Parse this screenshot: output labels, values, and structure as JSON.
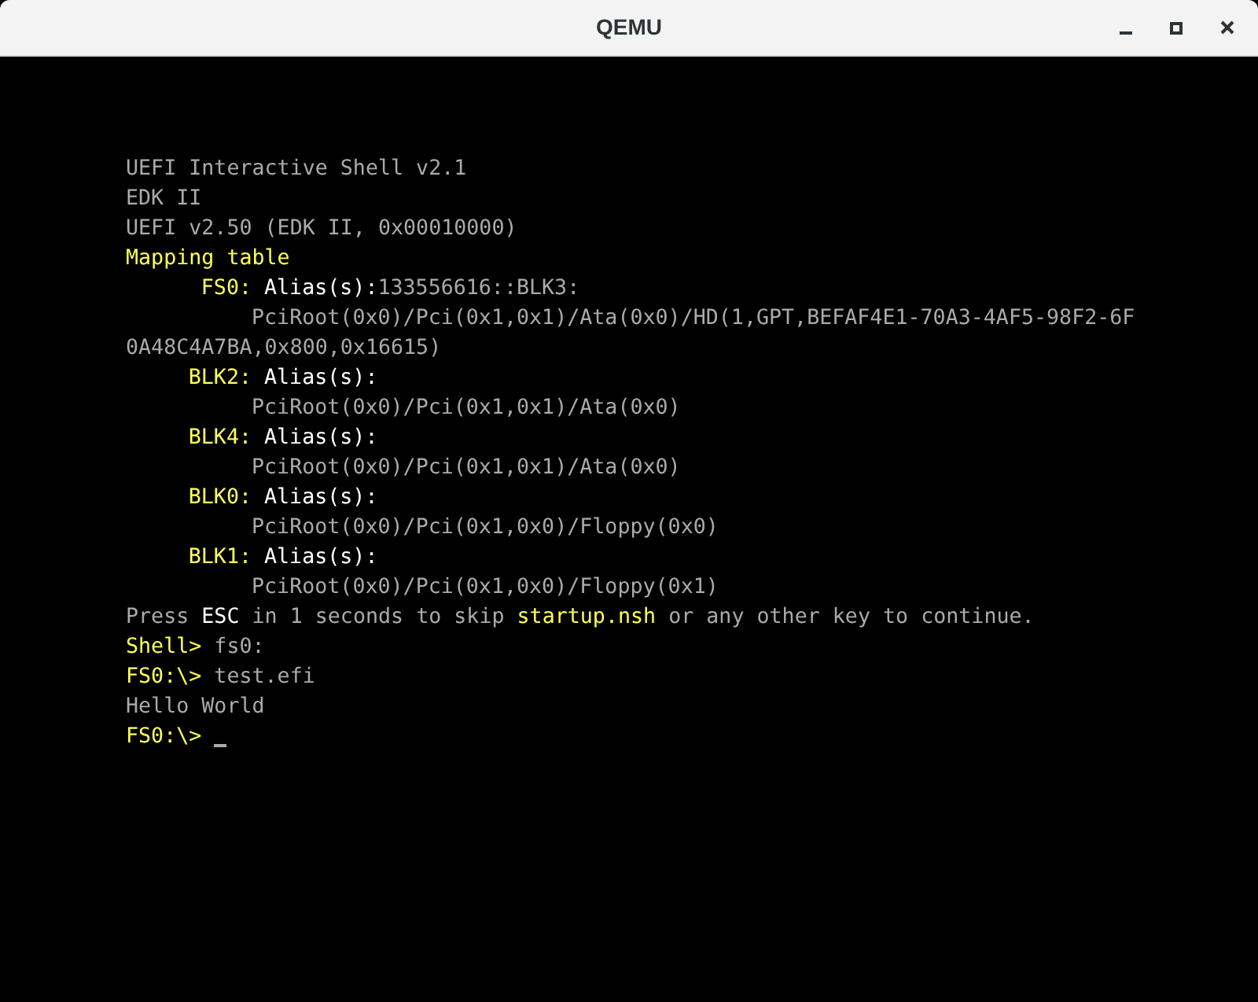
{
  "window": {
    "title": "QEMU"
  },
  "console": {
    "lines": [
      {
        "kind": "plain",
        "segments": [
          {
            "kind": "normal",
            "text": "UEFI Interactive Shell v2.1"
          }
        ]
      },
      {
        "kind": "plain",
        "segments": [
          {
            "kind": "normal",
            "text": "EDK II"
          }
        ]
      },
      {
        "kind": "plain",
        "segments": [
          {
            "kind": "normal",
            "text": "UEFI v2.50 (EDK II, 0x00010000)"
          }
        ]
      },
      {
        "kind": "plain",
        "segments": [
          {
            "kind": "highlight",
            "text": "Mapping table"
          }
        ]
      },
      {
        "kind": "device",
        "segments": [
          {
            "kind": "highlight",
            "text": "FS0:"
          },
          {
            "kind": "bright",
            "text": "Alias(s):"
          },
          {
            "kind": "normal",
            "text": "133556616::BLK3:"
          }
        ]
      },
      {
        "kind": "path",
        "segments": [
          {
            "kind": "normal",
            "text": "PciRoot(0x0)/Pci(0x1,0x1)/Ata(0x0)/HD(1,GPT,BEFAF4E1-70A3-4AF5-98F2-6F"
          }
        ]
      },
      {
        "kind": "plain",
        "segments": [
          {
            "kind": "normal",
            "text": "0A48C4A7BA,0x800,0x16615)"
          }
        ]
      },
      {
        "kind": "device",
        "segments": [
          {
            "kind": "highlight",
            "text": "BLK2:"
          },
          {
            "kind": "bright",
            "text": "Alias(s):"
          }
        ]
      },
      {
        "kind": "path",
        "segments": [
          {
            "kind": "normal",
            "text": "PciRoot(0x0)/Pci(0x1,0x1)/Ata(0x0)"
          }
        ]
      },
      {
        "kind": "device",
        "segments": [
          {
            "kind": "highlight",
            "text": "BLK4:"
          },
          {
            "kind": "bright",
            "text": "Alias(s):"
          }
        ]
      },
      {
        "kind": "path",
        "segments": [
          {
            "kind": "normal",
            "text": "PciRoot(0x0)/Pci(0x1,0x1)/Ata(0x0)"
          }
        ]
      },
      {
        "kind": "device",
        "segments": [
          {
            "kind": "highlight",
            "text": "BLK0:"
          },
          {
            "kind": "bright",
            "text": "Alias(s):"
          }
        ]
      },
      {
        "kind": "path",
        "segments": [
          {
            "kind": "normal",
            "text": "PciRoot(0x0)/Pci(0x1,0x0)/Floppy(0x0)"
          }
        ]
      },
      {
        "kind": "device",
        "segments": [
          {
            "kind": "highlight",
            "text": "BLK1:"
          },
          {
            "kind": "bright",
            "text": "Alias(s):"
          }
        ]
      },
      {
        "kind": "path",
        "segments": [
          {
            "kind": "normal",
            "text": "PciRoot(0x0)/Pci(0x1,0x0)/Floppy(0x1)"
          }
        ]
      },
      {
        "kind": "plain",
        "segments": [
          {
            "kind": "normal",
            "text": "Press "
          },
          {
            "kind": "bright",
            "text": "ESC"
          },
          {
            "kind": "normal",
            "text": " in 1 seconds to skip "
          },
          {
            "kind": "highlight",
            "text": "startup.nsh"
          },
          {
            "kind": "normal",
            "text": " or any other key to continue."
          }
        ]
      },
      {
        "kind": "plain",
        "segments": [
          {
            "kind": "highlight",
            "text": "Shell> "
          },
          {
            "kind": "normal",
            "text": "fs0:"
          }
        ]
      },
      {
        "kind": "plain",
        "segments": [
          {
            "kind": "highlight",
            "text": "FS0:\\> "
          },
          {
            "kind": "normal",
            "text": "test.efi"
          }
        ]
      },
      {
        "kind": "plain",
        "segments": [
          {
            "kind": "normal",
            "text": "Hello World"
          }
        ]
      },
      {
        "kind": "prompt",
        "segments": [
          {
            "kind": "highlight",
            "text": "FS0:\\> "
          }
        ]
      }
    ]
  }
}
